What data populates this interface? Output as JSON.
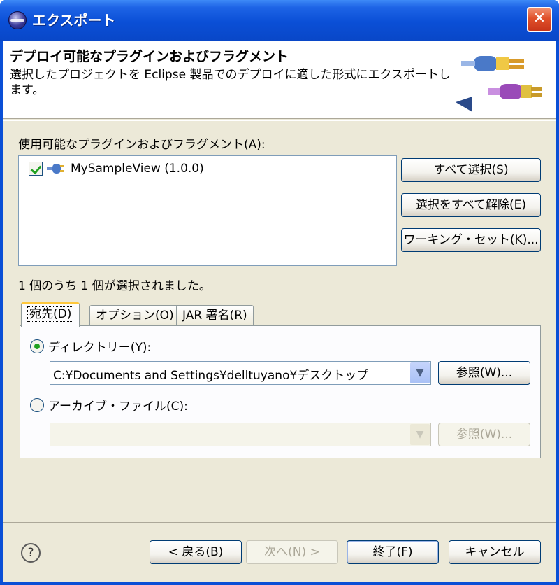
{
  "window": {
    "title": "エクスポート",
    "close_glyph": "✕"
  },
  "header": {
    "title": "デプロイ可能なプラグインおよびフラグメント",
    "description": "選択したプロジェクトを Eclipse 製品でのデプロイに適した形式にエクスポートします。",
    "icon": "plugin-export-icon"
  },
  "plugins": {
    "label": "使用可能なプラグインおよびフラグメント(A):",
    "items": [
      {
        "name": "MySampleView (1.0.0)",
        "checked": true
      }
    ],
    "select_all": "すべて選択(S)",
    "deselect_all": "選択をすべて解除(E)",
    "working_set": "ワーキング・セット(K)...",
    "selected_count": "1 個のうち 1 個が選択されました。"
  },
  "tabs": [
    {
      "label": "宛先(D)",
      "active": true
    },
    {
      "label": "オプション(O)",
      "active": false
    },
    {
      "label": "JAR 署名(R)",
      "active": false
    }
  ],
  "destination": {
    "directory_label": "ディレクトリー(Y):",
    "directory_value": "C:¥Documents and Settings¥delltuyano¥デスクトップ",
    "browse": "参照(W)...",
    "archive_label": "アーカイブ・ファイル(C):",
    "archive_value": "",
    "archive_browse": "参照(W)..."
  },
  "footer": {
    "help_glyph": "?",
    "back": "< 戻る(B)",
    "next": "次へ(N) >",
    "finish": "終了(F)",
    "cancel": "キャンセル"
  },
  "colors": {
    "titlebar": "#0a4fd6",
    "dialog": "#ece9d8",
    "button_border": "#003c74"
  }
}
